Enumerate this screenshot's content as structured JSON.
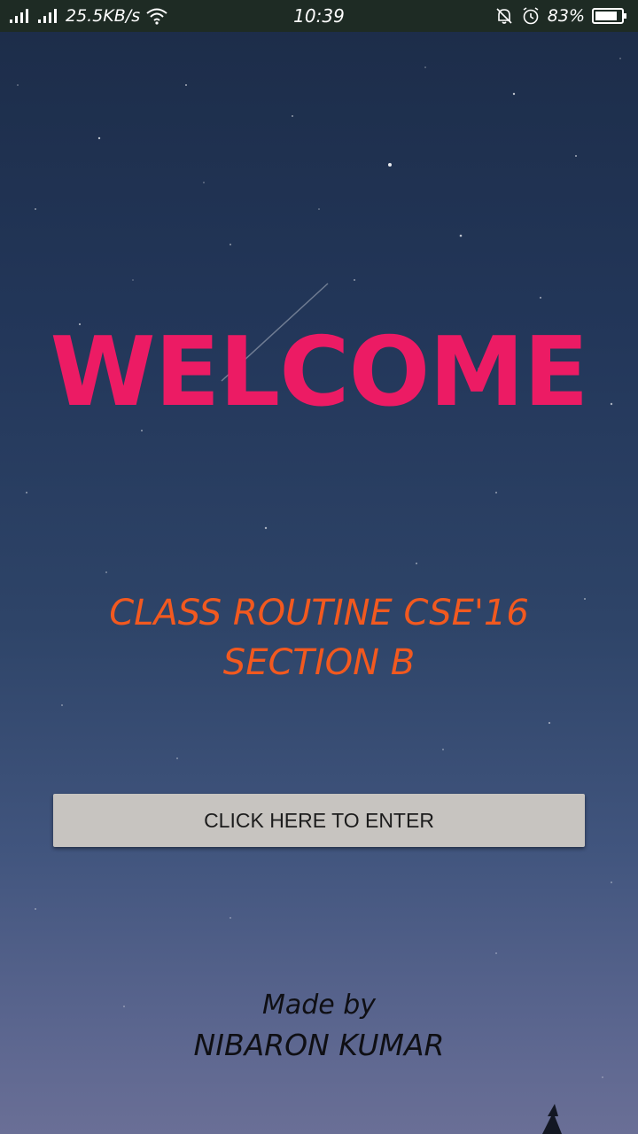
{
  "status_bar": {
    "network_speed": "25.5KB/s",
    "time": "10:39",
    "battery": "83%",
    "icons": [
      "signal-icon",
      "signal-icon",
      "wifi-icon",
      "bell-off-icon",
      "alarm-icon",
      "battery-icon"
    ]
  },
  "main": {
    "title": "WELCOME",
    "subtitle_line1": "CLASS ROUTINE CSE'16",
    "subtitle_line2": "SECTION B",
    "enter_button_label": "CLICK HERE TO ENTER",
    "credit_line1": "Made by",
    "credit_line2": "NIBARON KUMAR"
  },
  "colors": {
    "title": "#ec1b64",
    "subtitle": "#f2591f",
    "button_bg": "#c7c4c0",
    "status_bar_bg": "#1e2b24"
  }
}
